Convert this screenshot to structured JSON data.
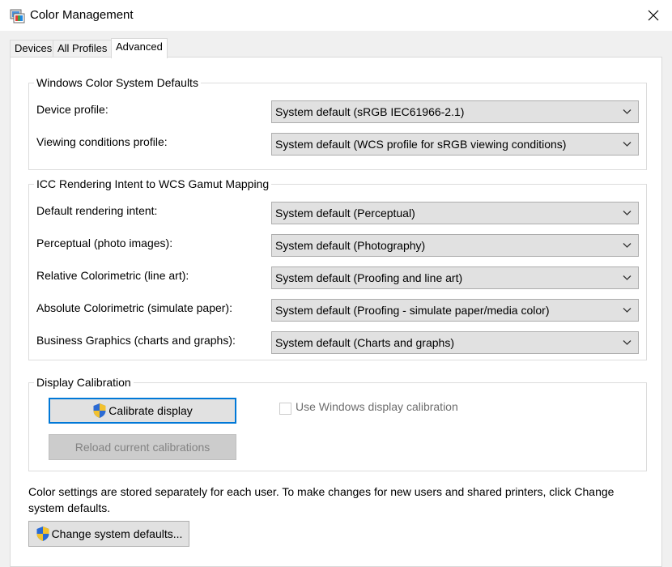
{
  "window": {
    "title": "Color Management",
    "icon": "color-management-icon",
    "close_icon": "close-icon"
  },
  "tabs": [
    {
      "label": "Devices",
      "active": false
    },
    {
      "label": "All Profiles",
      "active": false
    },
    {
      "label": "Advanced",
      "active": true
    }
  ],
  "wcs_defaults": {
    "title": "Windows Color System Defaults",
    "rows": [
      {
        "label": "Device profile:",
        "value": "System default (sRGB IEC61966-2.1)"
      },
      {
        "label": "Viewing conditions profile:",
        "value": "System default (WCS profile for sRGB viewing conditions)"
      }
    ]
  },
  "icc_mapping": {
    "title": "ICC Rendering Intent to WCS Gamut Mapping",
    "rows": [
      {
        "label": "Default rendering intent:",
        "value": "System default (Perceptual)"
      },
      {
        "label": "Perceptual (photo images):",
        "value": "System default (Photography)"
      },
      {
        "label": "Relative Colorimetric (line art):",
        "value": "System default (Proofing and line art)"
      },
      {
        "label": "Absolute Colorimetric (simulate paper):",
        "value": "System default (Proofing - simulate paper/media color)"
      },
      {
        "label": "Business Graphics (charts and graphs):",
        "value": "System default (Charts and graphs)"
      }
    ]
  },
  "display_calibration": {
    "title": "Display Calibration",
    "calibrate_label": "Calibrate display",
    "reload_label": "Reload current calibrations",
    "use_windows_calibration_label": "Use Windows display calibration",
    "use_windows_calibration_checked": false,
    "use_windows_calibration_enabled": false
  },
  "footer": {
    "note": "Color settings are stored separately for each user. To make changes for new users and shared printers, click Change system defaults.",
    "change_defaults_label": "Change system defaults..."
  },
  "colors": {
    "accent": "#0078d7",
    "shield_blue": "#2a6ad4",
    "shield_yellow": "#f2c12e"
  }
}
